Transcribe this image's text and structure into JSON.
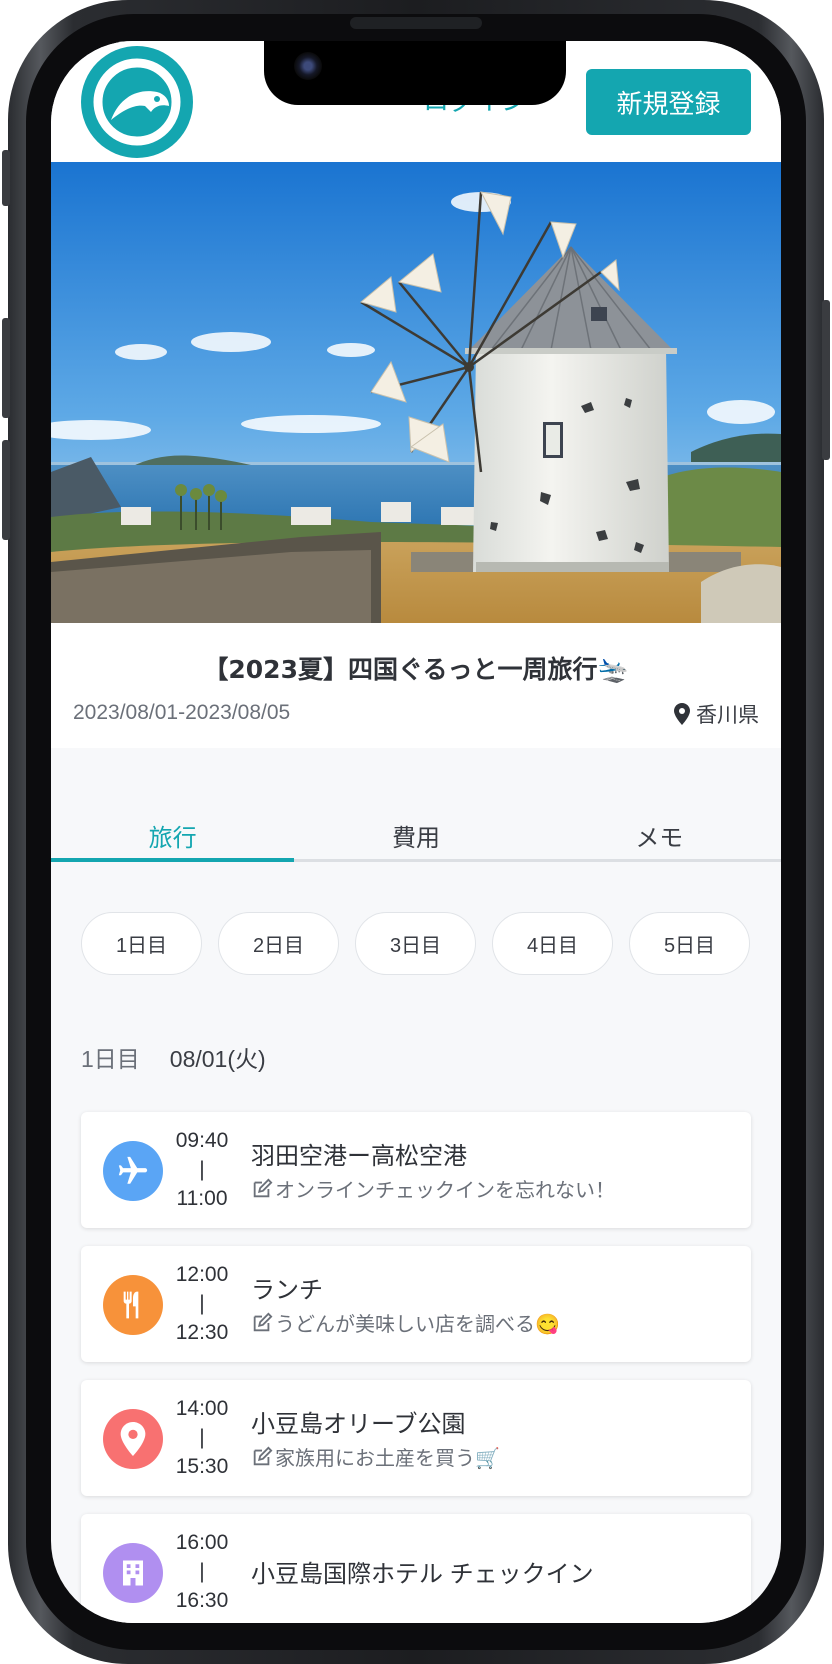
{
  "header": {
    "login_label": "ログイン",
    "signup_label": "新規登録"
  },
  "trip": {
    "title": "【2023夏】四国ぐるっと一周旅行🛬",
    "dates": "2023/08/01-2023/08/05",
    "location": "香川県"
  },
  "tabs": [
    {
      "label": "旅行",
      "active": true
    },
    {
      "label": "費用",
      "active": false
    },
    {
      "label": "メモ",
      "active": false
    }
  ],
  "days": [
    "1日目",
    "2日目",
    "3日目",
    "4日目",
    "5日目"
  ],
  "day_heading": {
    "label": "1日目",
    "date": "08/01(火)"
  },
  "schedule": [
    {
      "start": "09:40",
      "sep": "|",
      "end": "11:00",
      "title": "羽田空港ー高松空港",
      "memo": "オンラインチェックインを忘れない！",
      "icon": "airplane-icon",
      "color": "#5aa5f5"
    },
    {
      "start": "12:00",
      "sep": "|",
      "end": "12:30",
      "title": "ランチ",
      "memo": "うどんが美味しい店を調べる😋",
      "icon": "utensils-icon",
      "color": "#f7923a"
    },
    {
      "start": "14:00",
      "sep": "|",
      "end": "15:30",
      "title": "小豆島オリーブ公園",
      "memo": "家族用にお土産を買う🛒",
      "icon": "location-pin-icon",
      "color": "#f87171"
    },
    {
      "start": "16:00",
      "sep": "|",
      "end": "16:30",
      "title": "小豆島国際ホテル チェックイン",
      "memo": "",
      "icon": "hotel-icon",
      "color": "#b08ff0"
    }
  ],
  "colors": {
    "accent": "#14a6b0",
    "text": "#2f3238",
    "muted": "#6b7079",
    "background": "#f7f8fa"
  }
}
